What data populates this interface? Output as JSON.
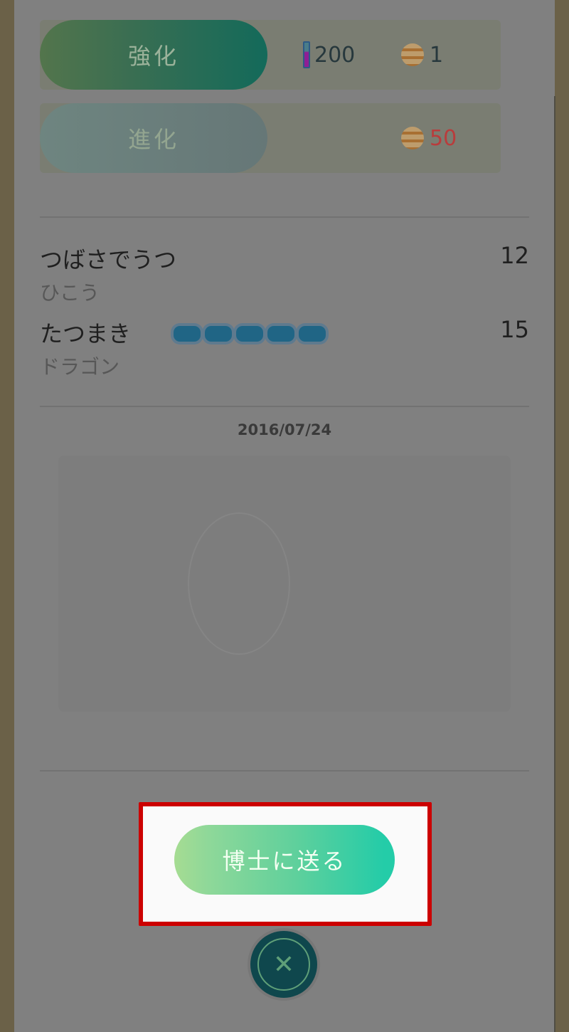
{
  "actions": {
    "power_up": {
      "label": "強化",
      "stardust_cost": "200",
      "candy_cost": "1"
    },
    "evolve": {
      "label": "進化",
      "candy_cost": "50"
    }
  },
  "moves": [
    {
      "name": "つばさでうつ",
      "type": "ひこう",
      "power": "12"
    },
    {
      "name": "たつまき",
      "type": "ドラゴン",
      "power": "15",
      "energy_bars": 5
    }
  ],
  "caught_date": "2016/07/24",
  "transfer_button": {
    "label": "博士に送る"
  },
  "close_button": {
    "icon": "close-icon",
    "glyph": "✕"
  },
  "colors": {
    "highlight_border": "#cc0000",
    "cost_warning": "#b93c3c"
  }
}
